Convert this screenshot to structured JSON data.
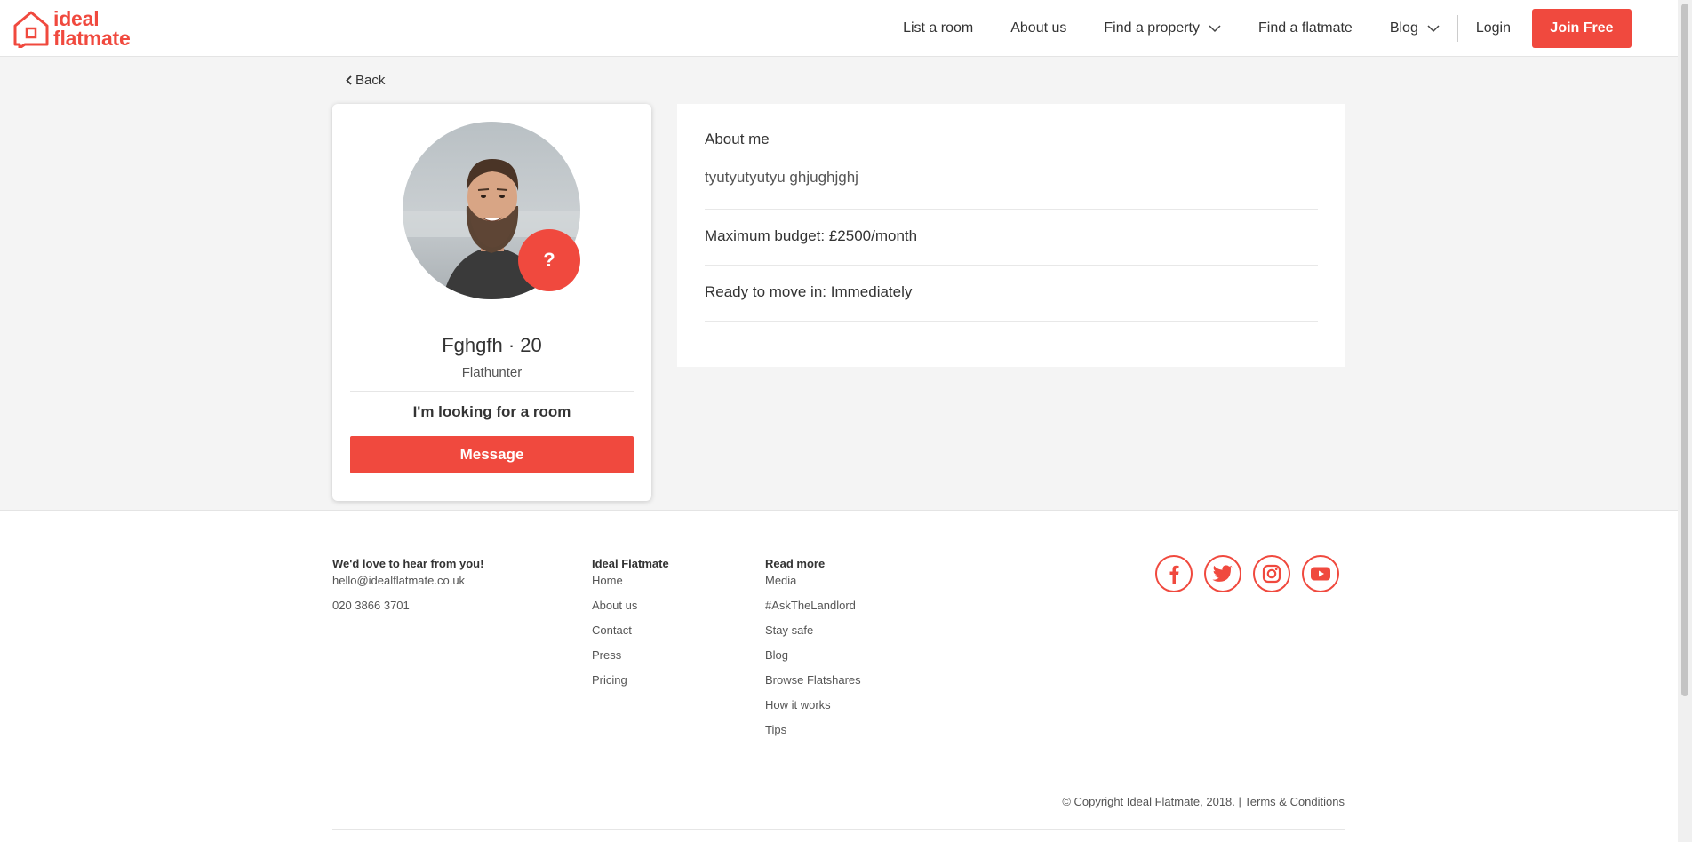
{
  "brand": {
    "logo_line1": "ideal",
    "logo_line2": "flatmate",
    "accent_color": "#f0493e"
  },
  "nav": {
    "list_room": "List a room",
    "about_us": "About us",
    "find_property": "Find a property",
    "find_flatmate": "Find a flatmate",
    "blog": "Blog",
    "login": "Login",
    "join": "Join Free"
  },
  "back_label": "Back",
  "profile": {
    "name": "Fghgfh",
    "separator": "·",
    "age": "20",
    "role": "Flathunter",
    "badge": "?",
    "looking_for": "I'm looking for a room",
    "message_label": "Message"
  },
  "details": {
    "about_title": "About me",
    "about_text": "tyutyutyutyu ghjughjghj",
    "budget": "Maximum budget: £2500/month",
    "move_in": "Ready to move in: Immediately"
  },
  "footer": {
    "contact_title": "We'd love to hear from you!",
    "email": "hello@idealflatmate.co.uk",
    "phone": "020 3866 3701",
    "company_title": "Ideal Flatmate",
    "company_links": [
      "Home",
      "About us",
      "Contact",
      "Press",
      "Pricing"
    ],
    "read_title": "Read more",
    "read_links": [
      "Media",
      "#AskTheLandlord",
      "Stay safe",
      "Blog",
      "Browse Flatshares",
      "How it works",
      "Tips"
    ],
    "social": [
      "facebook-icon",
      "twitter-icon",
      "instagram-icon",
      "youtube-icon"
    ],
    "copyright": "© Copyright Ideal Flatmate, 2018. |",
    "terms": "Terms & Conditions"
  }
}
